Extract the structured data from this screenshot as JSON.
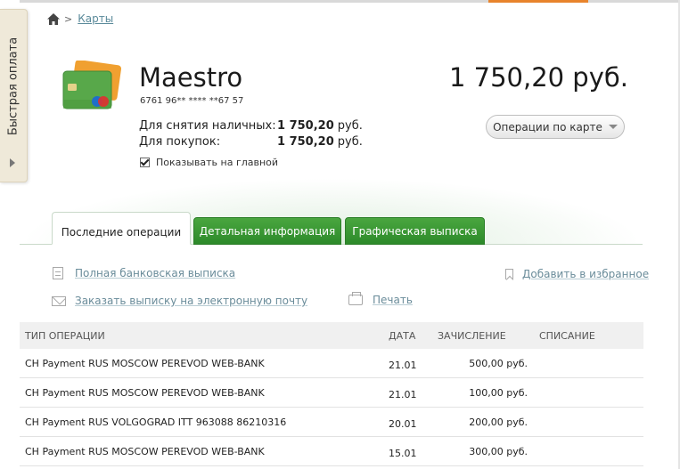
{
  "sidebar": {
    "quick_pay_label": "Быстрая оплата"
  },
  "breadcrumb": {
    "link": "Карты",
    "separator": ">"
  },
  "card": {
    "title": "Maestro",
    "number": "6761 96** **** **67 57",
    "balance": "1 750,20 руб.",
    "limits": [
      {
        "label": "Для снятия наличных:",
        "value": "1 750,20",
        "currency": "руб."
      },
      {
        "label": "Для покупок:",
        "value": "1 750,20",
        "currency": "руб."
      }
    ],
    "show_on_main_label": "Показывать на главной",
    "show_on_main_checked": true
  },
  "operations_button": {
    "label": "Операции по карте"
  },
  "tabs": [
    {
      "label": "Последние операции",
      "active": true
    },
    {
      "label": "Детальная информация",
      "active": false
    },
    {
      "label": "Графическая выписка",
      "active": false
    }
  ],
  "links": {
    "full_statement": "Полная банковская выписка",
    "email_statement": "Заказать выписку на электронную почту",
    "print": "Печать",
    "add_favorite": "Добавить в избранное"
  },
  "table": {
    "headers": {
      "type": "ТИП ОПЕРАЦИИ",
      "date": "ДАТА",
      "credit": "ЗАЧИСЛЕНИЕ",
      "debit": "СПИСАНИЕ"
    },
    "rows": [
      {
        "type": "CH Payment RUS MOSCOW PEREVOD WEB-BANK",
        "date": "21.01",
        "credit": "500,00 руб.",
        "debit": ""
      },
      {
        "type": "CH Payment RUS MOSCOW PEREVOD WEB-BANK",
        "date": "21.01",
        "credit": "100,00 руб.",
        "debit": ""
      },
      {
        "type": "CH Payment RUS VOLGOGRAD ITT 963088 86210316",
        "date": "20.01",
        "credit": "200,00 руб.",
        "debit": ""
      },
      {
        "type": "CH Payment RUS MOSCOW PEREVOD WEB-BANK",
        "date": "15.01",
        "credit": "300,00 руб.",
        "debit": ""
      }
    ]
  },
  "colors": {
    "green_tab": "#3a9a34",
    "link": "#6a8c9a",
    "accent_orange": "#e8842c"
  }
}
